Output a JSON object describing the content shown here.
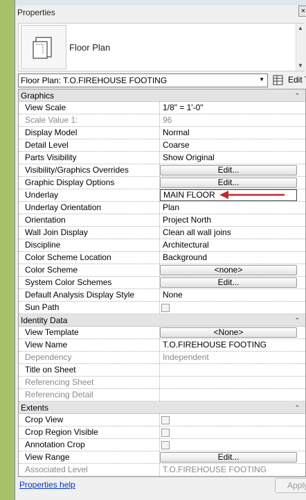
{
  "window": {
    "title": "Properties",
    "close_glyph": "×"
  },
  "type_selector": {
    "label": "Floor Plan",
    "icon": "floor-plan-icon"
  },
  "instance_selector": {
    "value": "Floor Plan: T.O.FIREHOUSE FOOTING",
    "edit_type_label": "Edit Type"
  },
  "groups": {
    "graphics": {
      "title": "Graphics",
      "rows": {
        "view_scale": {
          "name": "View Scale",
          "value": "1/8\" = 1'-0\""
        },
        "scale_value": {
          "name": "Scale Value    1:",
          "value": "96"
        },
        "display_model": {
          "name": "Display Model",
          "value": "Normal"
        },
        "detail_level": {
          "name": "Detail Level",
          "value": "Coarse"
        },
        "parts_visibility": {
          "name": "Parts Visibility",
          "value": "Show Original"
        },
        "vg_overrides": {
          "name": "Visibility/Graphics Overrides",
          "value": "Edit..."
        },
        "graphic_display": {
          "name": "Graphic Display Options",
          "value": "Edit..."
        },
        "underlay": {
          "name": "Underlay",
          "value": "MAIN FLOOR"
        },
        "underlay_orientation": {
          "name": "Underlay Orientation",
          "value": "Plan"
        },
        "orientation": {
          "name": "Orientation",
          "value": "Project North"
        },
        "wall_join": {
          "name": "Wall Join Display",
          "value": "Clean all wall joins"
        },
        "discipline": {
          "name": "Discipline",
          "value": "Architectural"
        },
        "color_scheme_location": {
          "name": "Color Scheme Location",
          "value": "Background"
        },
        "color_scheme": {
          "name": "Color Scheme",
          "value": "<none>"
        },
        "system_color_schemes": {
          "name": "System Color Schemes",
          "value": "Edit..."
        },
        "default_analysis": {
          "name": "Default Analysis Display Style",
          "value": "None"
        },
        "sun_path": {
          "name": "Sun Path",
          "checked": false
        }
      }
    },
    "identity": {
      "title": "Identity Data",
      "rows": {
        "view_template": {
          "name": "View Template",
          "value": "<None>"
        },
        "view_name": {
          "name": "View Name",
          "value": "T.O.FIREHOUSE FOOTING"
        },
        "dependency": {
          "name": "Dependency",
          "value": "Independent"
        },
        "title_on_sheet": {
          "name": "Title on Sheet",
          "value": ""
        },
        "referencing_sheet": {
          "name": "Referencing Sheet",
          "value": ""
        },
        "referencing_detail": {
          "name": "Referencing Detail",
          "value": ""
        }
      }
    },
    "extents": {
      "title": "Extents",
      "rows": {
        "crop_view": {
          "name": "Crop View",
          "checked": false
        },
        "crop_region_visible": {
          "name": "Crop Region Visible",
          "checked": false
        },
        "annotation_crop": {
          "name": "Annotation Crop",
          "checked": false
        },
        "view_range": {
          "name": "View Range",
          "value": "Edit..."
        },
        "associated_level": {
          "name": "Associated Level",
          "value": "T.O.FIREHOUSE FOOTING"
        }
      }
    }
  },
  "footer": {
    "help_link": "Properties help",
    "apply_label": "Apply"
  },
  "colors": {
    "annotation_arrow": "#c0282a",
    "link": "#0033cc"
  }
}
